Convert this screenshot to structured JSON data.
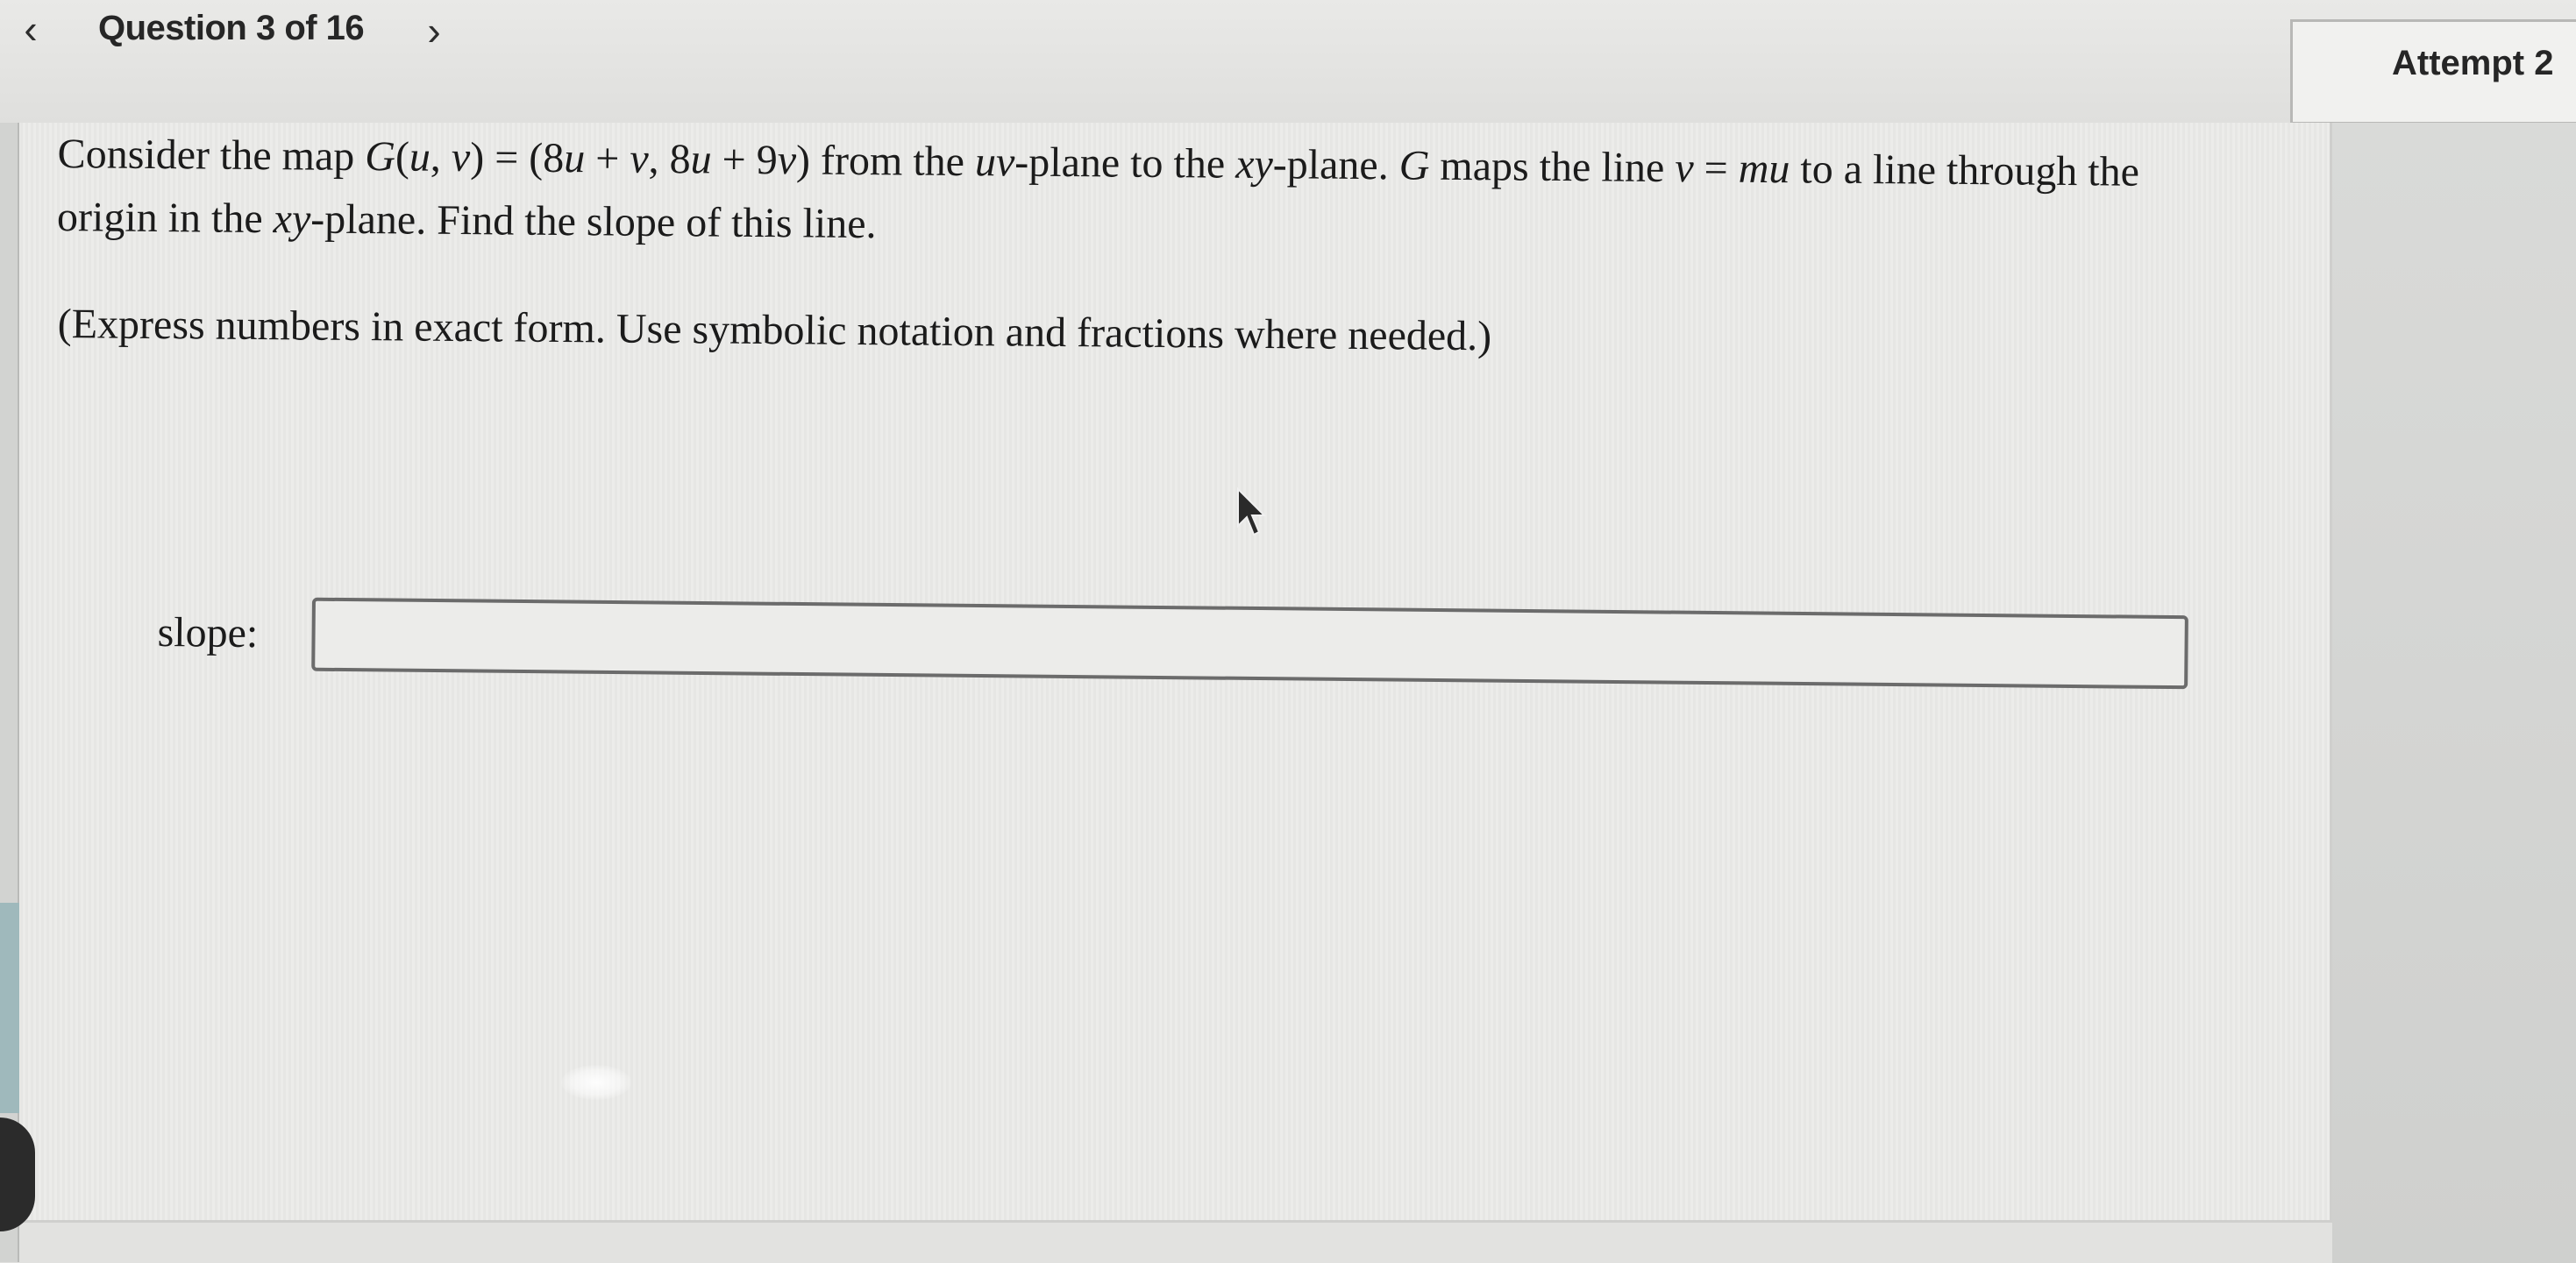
{
  "nav": {
    "prev_icon": "chevron-left-icon",
    "prev_glyph": "‹",
    "counter": "Question 3 of 16",
    "next_icon": "chevron-right-icon",
    "next_glyph": "›"
  },
  "attempt": {
    "label": "Attempt 2"
  },
  "question": {
    "line1_a": "Consider the map ",
    "line1_G": "G",
    "line1_b": "(",
    "line1_u": "u",
    "line1_c": ", ",
    "line1_v": "v",
    "line1_d": ") = (8",
    "line1_u2": "u",
    "line1_e": " + ",
    "line1_v2": "v",
    "line1_f": ", 8",
    "line1_u3": "u",
    "line1_g": " + 9",
    "line1_v3": "v",
    "line1_h": ") from the ",
    "line1_uv": "uv",
    "line1_i": "-plane to the ",
    "line1_xy": "xy",
    "line1_j": "-plane. ",
    "line1_G2": "G",
    "line1_k": " maps the line ",
    "line1_v4": "v",
    "line1_l": " = ",
    "line1_mu": "mu",
    "line1_m": " to a line through the",
    "line2_a": "origin in the ",
    "line2_xy": "xy",
    "line2_b": "-plane. Find the slope of this line."
  },
  "instruction": "(Express numbers in exact form. Use symbolic notation and fractions where needed.)",
  "answer": {
    "label": "slope:",
    "value": "",
    "placeholder": ""
  },
  "cursor_icon": "mouse-pointer-icon"
}
